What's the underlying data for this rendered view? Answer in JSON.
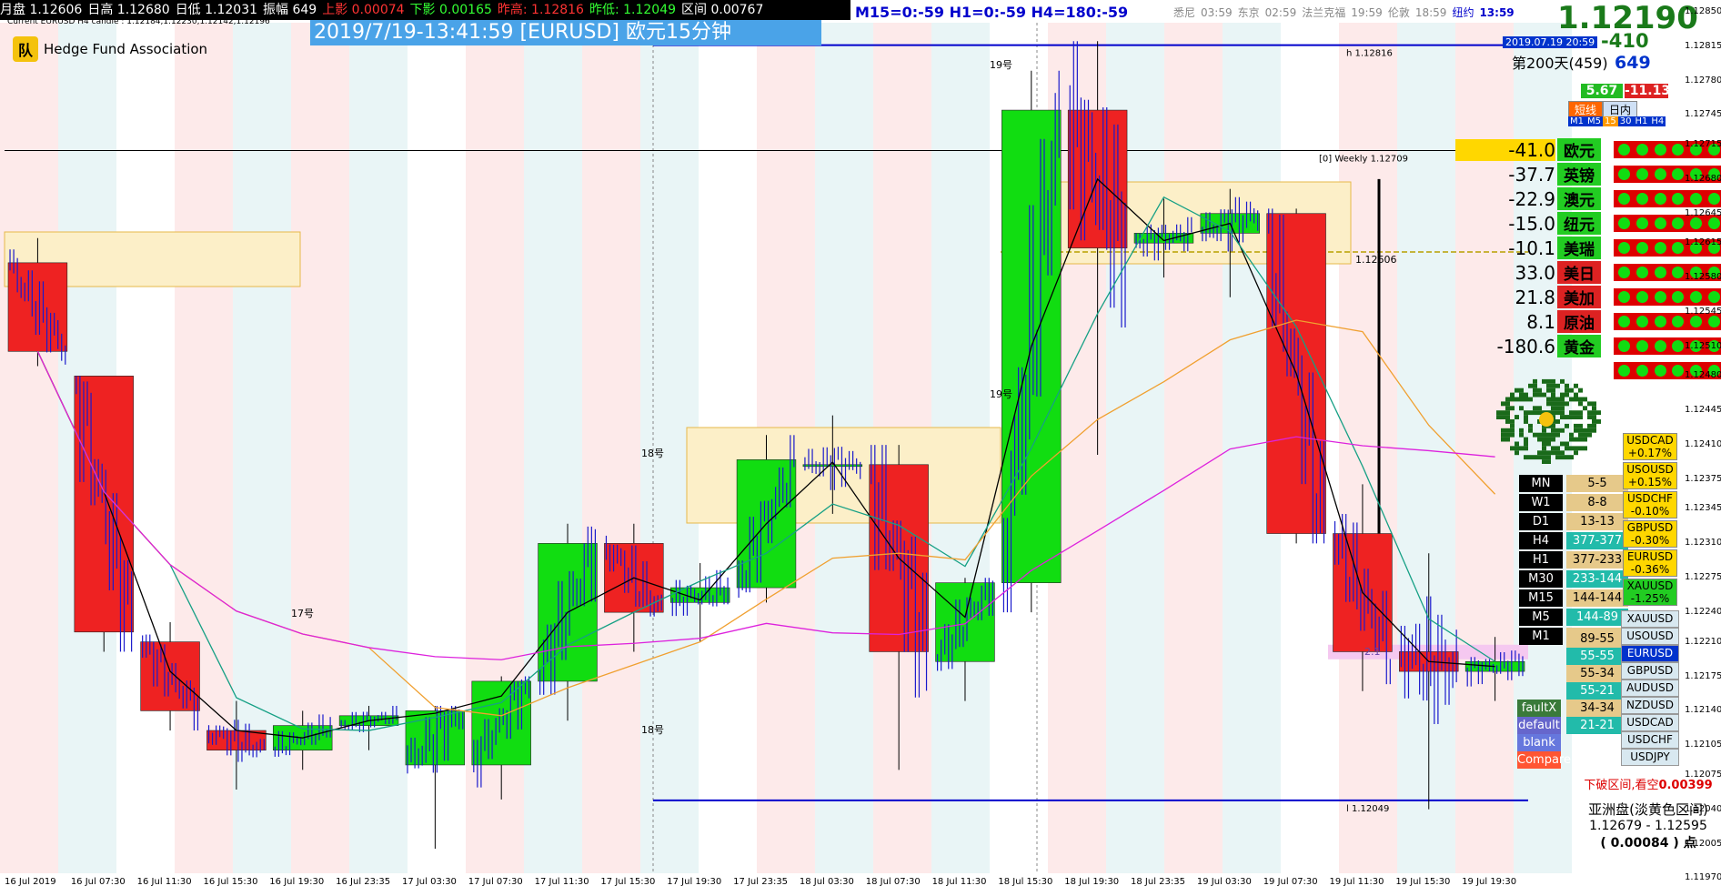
{
  "top_bar": {
    "items": [
      {
        "label": "月盘 1.12606",
        "color": "#ffffff"
      },
      {
        "label": "日高 1.12680",
        "color": "#ffffff"
      },
      {
        "label": "日低 1.12031",
        "color": "#ffffff"
      },
      {
        "label": "振幅 649",
        "color": "#ffffff"
      },
      {
        "label": "上影 0.00074",
        "color": "#ff3333"
      },
      {
        "label": "下影 0.00165",
        "color": "#33ff33"
      },
      {
        "label": "昨高: 1.12816",
        "color": "#ff3333"
      },
      {
        "label": "昨低: 1.12049",
        "color": "#33ff33"
      },
      {
        "label": "区间 0.00767",
        "color": "#ffffff"
      }
    ],
    "subtitle": "Current EURUSD H4 candle : 1.12184,1.12230,1.12142,1.12196"
  },
  "logo": {
    "mark": "队",
    "text": "Hedge Fund Association"
  },
  "banner": "2019/7/19-13:41:59 [EURUSD] 欧元15分钟",
  "tf_readout": "M15=0:-59  H1=0:-59  H4=180:-59",
  "sessions": [
    {
      "city": "悉尼",
      "time": "03:59",
      "active": false
    },
    {
      "city": "东京",
      "time": "02:59",
      "active": false
    },
    {
      "city": "法兰克福",
      "time": "19:59",
      "active": false
    },
    {
      "city": "伦敦",
      "time": "18:59",
      "active": false
    },
    {
      "city": "纽约",
      "time": "13:59",
      "active": true
    }
  ],
  "price": {
    "current": "1.12190",
    "date": "2019.07.19 20:59",
    "change": "-410",
    "day_label": "第200天(459)",
    "range": "649",
    "pos_badge": "5.67",
    "neg_badge": "-11.13"
  },
  "tabs": [
    "短线",
    "日内"
  ],
  "tf_buttons": [
    "M1",
    "M5",
    "15",
    "30",
    "H1",
    "H4"
  ],
  "strength": [
    {
      "value": "-41.0",
      "name": "欧元",
      "color": "#ffd700",
      "box": "#22cc22"
    },
    {
      "value": "-37.7",
      "name": "英镑",
      "color": "#000000",
      "box": "#22cc22"
    },
    {
      "value": "-22.9",
      "name": "澳元",
      "color": "#000000",
      "box": "#22cc22"
    },
    {
      "value": "-15.0",
      "name": "纽元",
      "color": "#000000",
      "box": "#22cc22"
    },
    {
      "value": "-10.1",
      "name": "美瑞",
      "color": "#000000",
      "box": "#22cc22"
    },
    {
      "value": "33.0",
      "name": "美日",
      "color": "#000000",
      "box": "#dd2222"
    },
    {
      "value": "21.8",
      "name": "美加",
      "color": "#000000",
      "box": "#dd2222"
    },
    {
      "value": "8.1",
      "name": "原油",
      "color": "#000000",
      "box": "#dd2222"
    },
    {
      "value": "-180.6",
      "name": "黄金",
      "color": "#000000",
      "box": "#22cc22"
    }
  ],
  "tf_levels": [
    {
      "tf": "MN",
      "val": "5-5"
    },
    {
      "tf": "W1",
      "val": "8-8"
    },
    {
      "tf": "D1",
      "val": "13-13"
    },
    {
      "tf": "H4",
      "val": "377-377"
    },
    {
      "tf": "H1",
      "val": "377-233"
    },
    {
      "tf": "M30",
      "val": "233-144"
    },
    {
      "tf": "M15",
      "val": "144-144"
    },
    {
      "tf": "M5",
      "val": "144-89"
    },
    {
      "tf": "M1",
      "val": "89-89"
    }
  ],
  "extra_levels": [
    {
      "label": "",
      "val": "89-55"
    },
    {
      "label": "",
      "val": "55-55"
    },
    {
      "label": "",
      "val": "55-34"
    },
    {
      "label": "",
      "val": "55-21"
    },
    {
      "label": "faultX",
      "val": "34-34"
    },
    {
      "label": "default",
      "val": "21-21"
    },
    {
      "label": "blank",
      "val": ""
    },
    {
      "label": "Compare",
      "val": ""
    }
  ],
  "pair_changes": [
    {
      "pair": "USDCAD",
      "chg": "+0.17%"
    },
    {
      "pair": "USOUSD",
      "chg": "+0.15%"
    },
    {
      "pair": "USDCHF",
      "chg": "-0.10%"
    },
    {
      "pair": "GBPUSD",
      "chg": "-0.30%"
    },
    {
      "pair": "EURUSD",
      "chg": "-0.36%"
    },
    {
      "pair": "XAUUSD",
      "chg": "-1.25%"
    }
  ],
  "pair_list": [
    "XAUUSD",
    "USOUSD",
    "EURUSD",
    "GBPUSD",
    "AUDUSD",
    "NZDUSD",
    "USDCAD",
    "USDCHF",
    "USDJPY"
  ],
  "bottom_info": {
    "breakout": "下破区间,看空",
    "breakout_val": "0.00399",
    "asia_label": "亚洲盘(淡黄色区间)",
    "asia_range": "1.12679 - 1.12595",
    "asia_points": "( 0.00084 ) 点"
  },
  "chart_labels": {
    "h_line": "h  1.12816",
    "l_line": "l  1.12049",
    "weekly": "[0] Weekly 1.12709",
    "mid": "1.12606",
    "fib": "2.1",
    "day_marks": [
      "17号",
      "18号",
      "18号",
      "19号",
      "19号"
    ]
  },
  "chart_data": {
    "type": "candlestick",
    "symbol": "EURUSD",
    "timeframe": "M15",
    "ylim": [
      1.11975,
      1.1286
    ],
    "y_ticks": [
      1.1285,
      1.12815,
      1.1278,
      1.12745,
      1.12715,
      1.1268,
      1.12645,
      1.12615,
      1.1258,
      1.12545,
      1.1251,
      1.1248,
      1.12445,
      1.1241,
      1.12375,
      1.12345,
      1.1231,
      1.12275,
      1.1224,
      1.1221,
      1.12175,
      1.1214,
      1.12105,
      1.12075,
      1.1204,
      1.12005,
      1.1197
    ],
    "x_labels": [
      "16 Jul 2019",
      "16 Jul 07:30",
      "16 Jul 11:30",
      "16 Jul 15:30",
      "16 Jul 19:30",
      "16 Jul 23:35",
      "17 Jul 03:30",
      "17 Jul 07:30",
      "17 Jul 11:30",
      "17 Jul 15:30",
      "17 Jul 19:30",
      "17 Jul 23:35",
      "18 Jul 03:30",
      "18 Jul 07:30",
      "18 Jul 11:30",
      "18 Jul 15:30",
      "18 Jul 19:30",
      "18 Jul 23:35",
      "19 Jul 03:30",
      "19 Jul 07:30",
      "19 Jul 11:30",
      "19 Jul 15:30",
      "19 Jul 19:30"
    ],
    "h4_candles": [
      {
        "o": 1.12595,
        "h": 1.1262,
        "c": 1.12505,
        "l": 1.1249
      },
      {
        "o": 1.1248,
        "h": 1.1248,
        "c": 1.1222,
        "l": 1.122
      },
      {
        "o": 1.1221,
        "h": 1.1223,
        "c": 1.1214,
        "l": 1.1212
      },
      {
        "o": 1.1212,
        "h": 1.1215,
        "c": 1.121,
        "l": 1.1206
      },
      {
        "o": 1.121,
        "h": 1.1214,
        "c": 1.12125,
        "l": 1.1208
      },
      {
        "o": 1.12125,
        "h": 1.12145,
        "c": 1.12135,
        "l": 1.121
      },
      {
        "o": 1.12085,
        "h": 1.12145,
        "c": 1.1214,
        "l": 1.12
      },
      {
        "o": 1.12085,
        "h": 1.12175,
        "c": 1.1217,
        "l": 1.1205
      },
      {
        "o": 1.1217,
        "h": 1.1233,
        "c": 1.1231,
        "l": 1.1213
      },
      {
        "o": 1.1231,
        "h": 1.1233,
        "c": 1.1224,
        "l": 1.122
      },
      {
        "o": 1.1225,
        "h": 1.1229,
        "c": 1.12265,
        "l": 1.1221
      },
      {
        "o": 1.12265,
        "h": 1.1242,
        "c": 1.12395,
        "l": 1.1225
      },
      {
        "o": 1.1239,
        "h": 1.1244,
        "c": 1.1239,
        "l": 1.1234
      },
      {
        "o": 1.1239,
        "h": 1.1241,
        "c": 1.122,
        "l": 1.1208
      },
      {
        "o": 1.1219,
        "h": 1.12275,
        "c": 1.1227,
        "l": 1.1215
      },
      {
        "o": 1.1227,
        "h": 1.1279,
        "c": 1.1275,
        "l": 1.1224
      },
      {
        "o": 1.1275,
        "h": 1.1282,
        "c": 1.1261,
        "l": 1.124
      },
      {
        "o": 1.12615,
        "h": 1.1266,
        "c": 1.12625,
        "l": 1.1258
      },
      {
        "o": 1.12625,
        "h": 1.1267,
        "c": 1.12645,
        "l": 1.1256
      },
      {
        "o": 1.12645,
        "h": 1.1265,
        "c": 1.1232,
        "l": 1.1231
      },
      {
        "o": 1.1232,
        "h": 1.1237,
        "c": 1.122,
        "l": 1.1216
      },
      {
        "o": 1.122,
        "h": 1.123,
        "c": 1.1218,
        "l": 1.1204
      },
      {
        "o": 1.1218,
        "h": 1.12215,
        "c": 1.1219,
        "l": 1.1215
      }
    ],
    "levels": {
      "h": 1.12816,
      "l": 1.12049,
      "weekly": 1.12709,
      "mid": 1.12606,
      "current": 1.12196
    }
  }
}
